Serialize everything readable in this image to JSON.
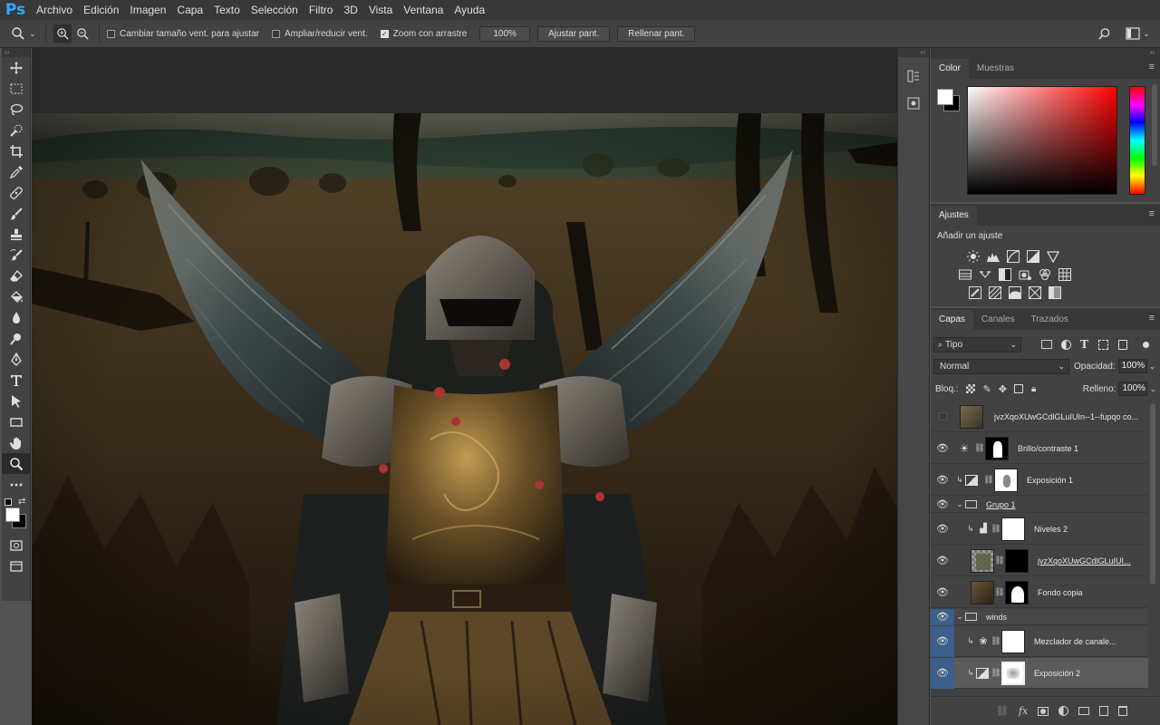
{
  "app": {
    "logo": "Ps"
  },
  "menu": [
    "Archivo",
    "Edición",
    "Imagen",
    "Capa",
    "Texto",
    "Selección",
    "Filtro",
    "3D",
    "Vista",
    "Ventana",
    "Ayuda"
  ],
  "options": {
    "resize_windows": "Cambiar tamaño vent. para ajustar",
    "zoom_all": "Ampliar/reducir vent.",
    "scrubby_zoom": "Zoom con arrastre",
    "zoom_value": "100%",
    "fit_screen": "Ajustar pant.",
    "fill_screen": "Rellenar pant."
  },
  "color_panel": {
    "tabs": [
      "Color",
      "Muestras"
    ],
    "foreground": "#ffffff",
    "background": "#000000"
  },
  "adjustments": {
    "tab": "Ajustes",
    "title": "Añadir un ajuste"
  },
  "layers_panel": {
    "tabs": [
      "Capas",
      "Canales",
      "Trazados"
    ],
    "filter_kind": "Tipo",
    "blend_mode": "Normal",
    "opacity_label": "Opacidad:",
    "opacity": "100%",
    "lock_label": "Bloq.:",
    "fill_label": "Relleno:",
    "fill": "100%",
    "layers": [
      {
        "name": "jvzXqoXUwGCdlGLuIUIn--1--fupqo co...",
        "visible": false,
        "kind": "smart"
      },
      {
        "name": "Brillo/contraste 1",
        "visible": true,
        "kind": "adjust"
      },
      {
        "name": "Exposición 1",
        "visible": true,
        "kind": "adjust"
      },
      {
        "name": "Grupo 1",
        "visible": true,
        "kind": "group"
      },
      {
        "name": "Niveles 2",
        "visible": true,
        "kind": "adjust"
      },
      {
        "name": "jvzXqoXUwGCdlGLuIUI...",
        "visible": true,
        "kind": "smart"
      },
      {
        "name": "Fondo copia",
        "visible": true,
        "kind": "pixel"
      },
      {
        "name": "winds",
        "visible": true,
        "kind": "group"
      },
      {
        "name": "Mezclador de canale...",
        "visible": true,
        "kind": "adjust"
      },
      {
        "name": "Exposición 2",
        "visible": true,
        "kind": "adjust"
      }
    ]
  }
}
